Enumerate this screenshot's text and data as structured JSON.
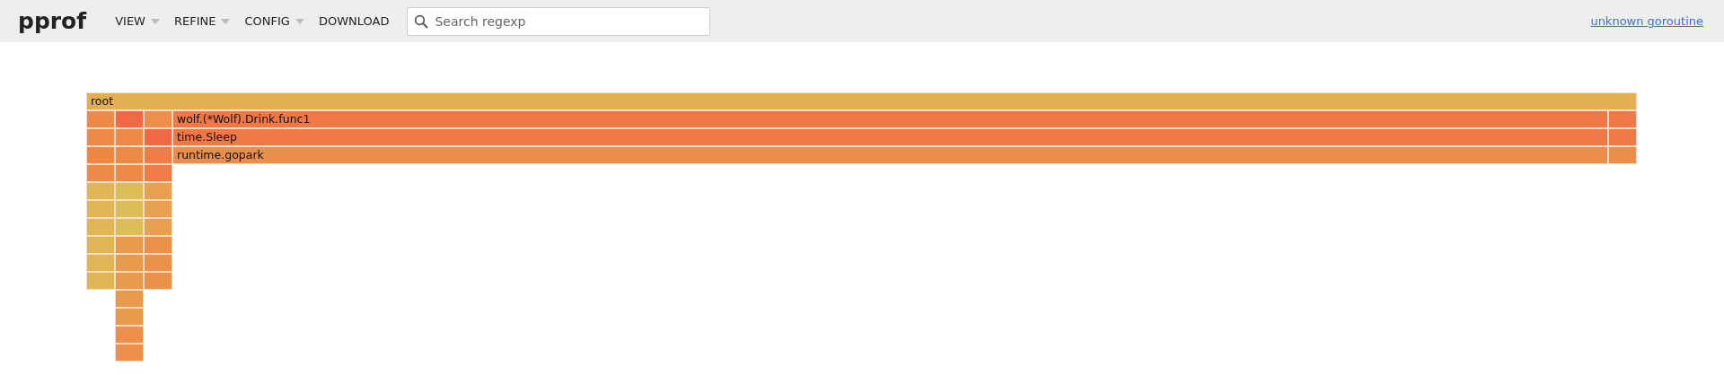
{
  "header": {
    "logo": "pprof",
    "menus": [
      {
        "label": "VIEW",
        "dropdown": true
      },
      {
        "label": "REFINE",
        "dropdown": true
      },
      {
        "label": "CONFIG",
        "dropdown": true
      },
      {
        "label": "DOWNLOAD",
        "dropdown": false
      }
    ],
    "search": {
      "placeholder": "Search regexp"
    },
    "link": "unknown goroutine"
  },
  "flame_graph": {
    "root": {
      "name": "root",
      "color": "#e2b052",
      "children": [
        {
          "color": "#ec8a48",
          "children": [
            {
              "color": "#ec8a48",
              "children": [
                {
                  "color": "#ee8644",
                  "children": [
                    {
                      "color": "#ec8a48",
                      "children": [
                        {
                          "color": "#e0b656",
                          "children": [
                            {
                              "color": "#e0b656",
                              "children": [
                                {
                                  "color": "#e0b656",
                                  "children": [
                                    {
                                      "color": "#e0b656",
                                      "children": [
                                        {
                                          "color": "#e0b656",
                                          "children": [
                                            {
                                              "color": "#e0b656"
                                            }
                                          ]
                                        }
                                      ]
                                    }
                                  ]
                                }
                              ]
                            }
                          ]
                        }
                      ]
                    }
                  ]
                }
              ]
            }
          ]
        },
        {
          "color": "#f06844",
          "children": [
            {
              "color": "#ec8a48",
              "children": [
                {
                  "color": "#ec8a48",
                  "children": [
                    {
                      "color": "#ec8a48",
                      "children": [
                        {
                          "color": "#dcbe58",
                          "children": [
                            {
                              "color": "#dcbe58",
                              "children": [
                                {
                                  "color": "#dcbe58",
                                  "children": [
                                    {
                                      "color": "#e89a4e",
                                      "children": [
                                        {
                                          "color": "#e89a4e",
                                          "children": [
                                            {
                                              "color": "#e89a4e",
                                              "children": [
                                                {
                                                  "color": "#e89a4e",
                                                  "children": [
                                                    {
                                                      "color": "#e89a4e",
                                                      "children": [
                                                        {
                                                          "color": "#ec8e4c",
                                                          "children": [
                                                            {
                                                              "color": "#ec8e4c"
                                                            }
                                                          ]
                                                        }
                                                      ]
                                                    }
                                                  ]
                                                }
                                              ]
                                            }
                                          ]
                                        }
                                      ]
                                    }
                                  ]
                                }
                              ]
                            }
                          ]
                        }
                      ]
                    }
                  ]
                }
              ]
            }
          ]
        },
        {
          "color": "#ec8e4c",
          "children": [
            {
              "color": "#f06844",
              "children": [
                {
                  "color": "#ef7b46",
                  "children": [
                    {
                      "color": "#ef7b46",
                      "children": [
                        {
                          "color": "#e6a050",
                          "children": [
                            {
                              "color": "#e6a050",
                              "children": [
                                {
                                  "color": "#e6a050",
                                  "children": [
                                    {
                                      "color": "#ea924c",
                                      "children": [
                                        {
                                          "color": "#ea924c",
                                          "children": [
                                            {
                                              "color": "#ea924c"
                                            }
                                          ]
                                        }
                                      ]
                                    }
                                  ]
                                }
                              ]
                            }
                          ]
                        }
                      ]
                    }
                  ]
                }
              ]
            }
          ]
        },
        {
          "name": "wolf.(*Wolf).Drink.func1",
          "color": "#ee7946",
          "children": [
            {
              "name": "time.Sleep",
              "color": "#ee7946",
              "children": [
                {
                  "name": "runtime.gopark",
                  "color": "#ea8e4c"
                }
              ]
            }
          ]
        },
        {
          "color": "#ee7946",
          "children": [
            {
              "color": "#ee7946",
              "children": [
                {
                  "color": "#ea8e4c"
                }
              ]
            }
          ]
        }
      ]
    }
  }
}
